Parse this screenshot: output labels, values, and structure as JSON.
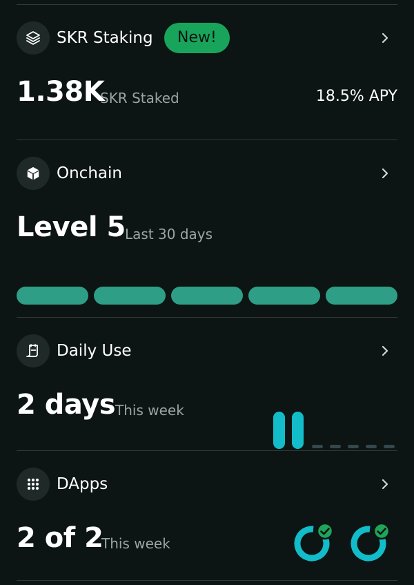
{
  "staking": {
    "title": "SKR Staking",
    "badge": "New!",
    "value": "1.38K",
    "value_label": "SKR Staked",
    "apy": "18.5% APY"
  },
  "onchain": {
    "title": "Onchain",
    "value": "Level 5",
    "value_label": "Last 30 days",
    "segments_filled": 5,
    "segments_total": 5
  },
  "daily_use": {
    "title": "Daily Use",
    "value": "2 days",
    "value_label": "This week",
    "days_active": 2,
    "days_total": 7
  },
  "dapps": {
    "title": "DApps",
    "value": "2 of 2",
    "value_label": "This week",
    "completed": 2,
    "total": 2
  },
  "colors": {
    "background": "#0d1514",
    "badge_green": "#18a55b",
    "level_bar": "#2f9e86",
    "daily_bar": "#12bcc8",
    "dapp_ring": "#12bcc8",
    "check_green": "#1fa55a"
  },
  "icons": {
    "staking": "layers-icon",
    "onchain": "cube-icon",
    "daily_use": "calendar-icon",
    "dapps": "grid-icon",
    "chevron": "chevron-right-icon",
    "check": "check-icon"
  }
}
